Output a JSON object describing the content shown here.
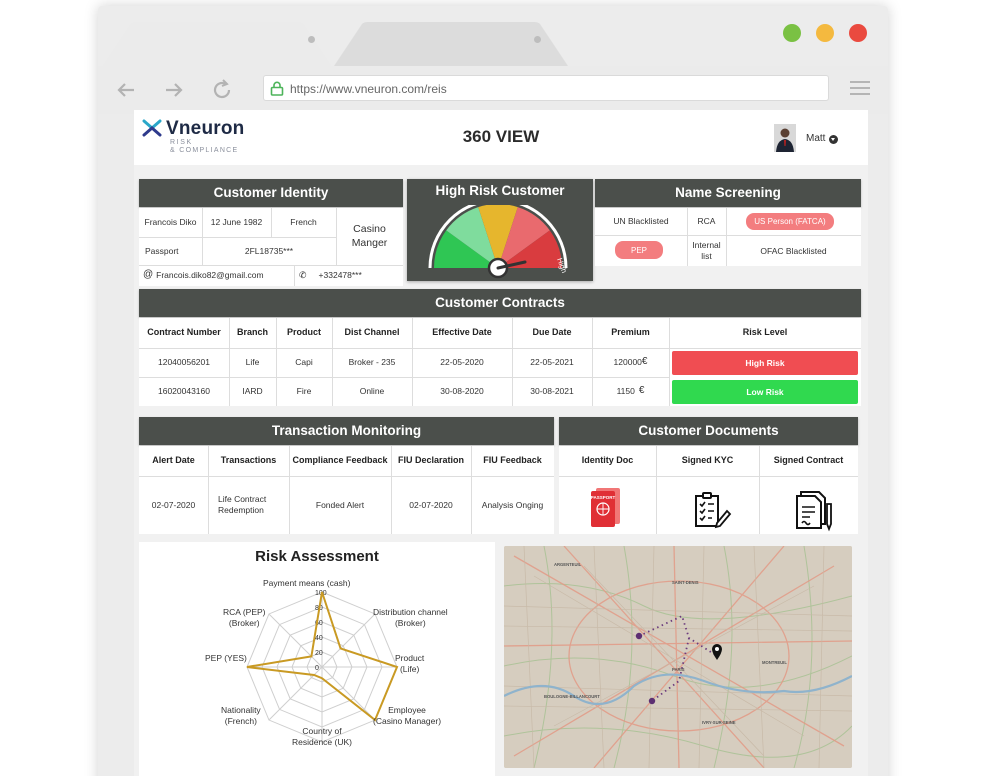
{
  "browser": {
    "url": "https://www.vneuron.com/reis",
    "window_buttons": [
      "#7ac143",
      "#f4b93f",
      "#ea4a3f"
    ]
  },
  "header": {
    "logo_name": "Vneuron",
    "logo_tag1": "RISK",
    "logo_tag2": "& COMPLIANCE",
    "title": "360 VIEW",
    "user": "Matt"
  },
  "identity": {
    "title": "Customer Identity",
    "name": "Francois Diko",
    "birth_date": "12 June 1982",
    "nationality": "French",
    "occupation": "Casino Manger",
    "id_type": "Passport",
    "id_number": "2FL18735***",
    "email": "Francois.diko82@gmail.com",
    "phone": "+332478***"
  },
  "risk_gauge": {
    "title": "High Risk Customer",
    "label": "High",
    "colors": [
      "#2fc654",
      "#7fdc9d",
      "#e6b62d",
      "#e96a6e",
      "#d93c3f"
    ]
  },
  "screening": {
    "title": "Name Screening",
    "un": "UN Blacklisted",
    "rca": "RCA",
    "us_person": "US Person (FATCA)",
    "pep": "PEP",
    "internal": "Internal list",
    "ofac": "OFAC Blacklisted"
  },
  "contracts": {
    "title": "Customer Contracts",
    "headers": [
      "Contract Number",
      "Branch",
      "Product",
      "Dist Channel",
      "Effective Date",
      "Due Date",
      "Premium",
      "Risk Level"
    ],
    "rows": [
      {
        "number": "12040056201",
        "branch": "Life",
        "product": "Capi",
        "channel": "Broker - 235",
        "effective": "22-05-2020",
        "due": "22-05-2021",
        "premium": "120000",
        "currency": "€",
        "risk": "High Risk",
        "risk_color": "#f04d52"
      },
      {
        "number": "16020043160",
        "branch": "IARD",
        "product": "Fire",
        "channel": "Online",
        "effective": "30-08-2020",
        "due": "30-08-2021",
        "premium": "1150",
        "currency": "€",
        "risk": "Low Risk",
        "risk_color": "#30d94f"
      }
    ]
  },
  "transactions": {
    "title": "Transaction Monitoring",
    "headers": [
      "Alert Date",
      "Transactions",
      "Compliance Feedback",
      "FIU Declaration",
      "FIU Feedback"
    ],
    "row": {
      "alert_date": "02-07-2020",
      "transaction": "Life Contract Redemption",
      "compliance": "Fonded Alert",
      "declaration": "02-07-2020",
      "feedback": "Analysis Onging"
    }
  },
  "documents": {
    "title": "Customer Documents",
    "headers": [
      "Identity Doc",
      "Signed KYC",
      "Signed Contract"
    ],
    "passport_label": "PASSPORT"
  },
  "risk_assessment": {
    "title": "Risk Assessment",
    "axes": [
      {
        "label": "Payment means (cash)",
        "value": 100
      },
      {
        "label": "Distribution channel (Broker)",
        "value": 35
      },
      {
        "label": "Product (Life)",
        "value": 100
      },
      {
        "label": "Employee (Casino Manager)",
        "value": 100
      },
      {
        "label": "Country of Residence (UK)",
        "value": 15
      },
      {
        "label": "Nationality (French)",
        "value": 15
      },
      {
        "label": "PEP (YES)",
        "value": 100
      },
      {
        "label": "RCA (PEP)",
        "value": 20
      }
    ],
    "ticks": [
      "100",
      "80",
      "60",
      "40",
      "20",
      "0"
    ],
    "line_color": "#c99a23"
  },
  "map": {
    "places": [
      "ARGENTEUIL",
      "SAINT-DENIS",
      "PARIS",
      "MONTREUIL",
      "BOULOGNE-BILLANCOURT",
      "IVRY-SUR-SEINE"
    ]
  }
}
